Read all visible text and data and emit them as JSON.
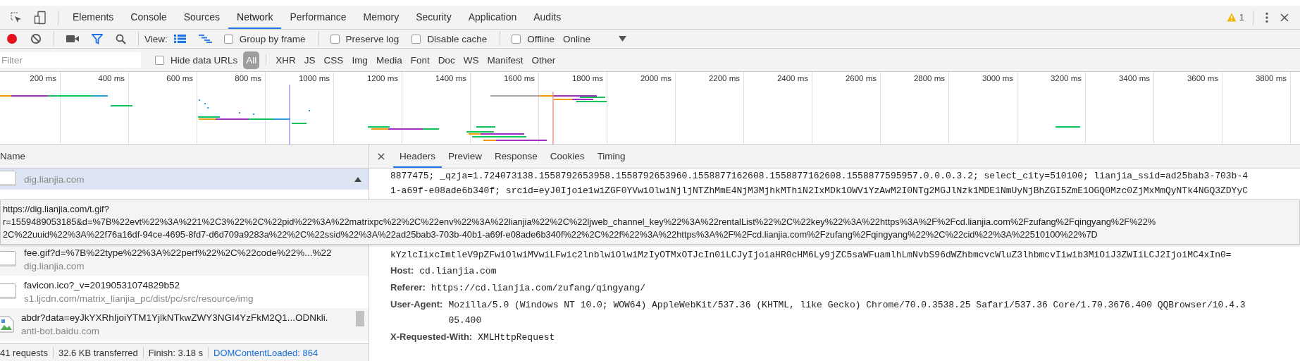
{
  "main_tabs": [
    {
      "label": "Elements",
      "selected": false
    },
    {
      "label": "Console",
      "selected": false
    },
    {
      "label": "Sources",
      "selected": false
    },
    {
      "label": "Network",
      "selected": true
    },
    {
      "label": "Performance",
      "selected": false
    },
    {
      "label": "Memory",
      "selected": false
    },
    {
      "label": "Security",
      "selected": false
    },
    {
      "label": "Application",
      "selected": false
    },
    {
      "label": "Audits",
      "selected": false
    }
  ],
  "issues": {
    "count": "1"
  },
  "toolbar": {
    "recording": true,
    "filter_active": true,
    "view_label": "View:",
    "view_modes": [
      {
        "kind": "list",
        "selected": true
      },
      {
        "kind": "waterfall",
        "selected": false
      }
    ],
    "group_by_frame": {
      "label": "Group by frame",
      "checked": false
    },
    "preserve_log": {
      "label": "Preserve log",
      "checked": false
    },
    "disable_cache": {
      "label": "Disable cache",
      "checked": false
    },
    "offline": {
      "label": "Offline",
      "checked": false
    },
    "throttling": "Online"
  },
  "filter": {
    "placeholder": "Filter",
    "hide_data_urls": {
      "label": "Hide data URLs",
      "checked": false
    },
    "types": [
      {
        "label": "All",
        "selected": true
      },
      {
        "label": "XHR",
        "selected": false
      },
      {
        "label": "JS",
        "selected": false
      },
      {
        "label": "CSS",
        "selected": false
      },
      {
        "label": "Img",
        "selected": false
      },
      {
        "label": "Media",
        "selected": false
      },
      {
        "label": "Font",
        "selected": false
      },
      {
        "label": "Doc",
        "selected": false
      },
      {
        "label": "WS",
        "selected": false
      },
      {
        "label": "Manifest",
        "selected": false
      },
      {
        "label": "Other",
        "selected": false
      }
    ]
  },
  "timeline": {
    "ticks": [
      "200 ms",
      "400 ms",
      "600 ms",
      "800 ms",
      "1000 ms",
      "1200 ms",
      "1400 ms",
      "1600 ms",
      "1800 ms",
      "2000 ms",
      "2200 ms",
      "2400 ms",
      "2600 ms",
      "2800 ms",
      "3000 ms",
      "3200 ms",
      "3400 ms",
      "3600 ms",
      "3800 ms"
    ]
  },
  "requests": {
    "header": "Name",
    "rows": [
      {
        "kind": "document",
        "domain": "dig.lianjia.com",
        "selected": true
      },
      {
        "kind": "document",
        "name": "fee.gif?d=%7B%22type%22%3A%22perf%22%2C%22code%22%...%22",
        "domain": "dig.lianjia.com",
        "selected": false
      },
      {
        "kind": "document",
        "name": "favicon.ico?_v=20190531074829b52",
        "domain": "s1.ljcdn.com/matrix_lianjia_pc/dist/pc/src/resource/img",
        "selected": false
      },
      {
        "kind": "image",
        "name": "abdr?data=eyJkYXRhIjoiYTM1YjlkNTkwZWY3NGI4YzFkM2Q1...ODNkli.",
        "domain": "anti-bot.baidu.com",
        "selected": false
      }
    ]
  },
  "tooltip": {
    "lines": [
      "https://dig.lianjia.com/t.gif?",
      "r=1559489053185&d=%7B%22evt%22%3A%221%2C3%22%2C%22pid%22%3A%22matrixpc%22%2C%22env%22%3A%22lianjia%22%2C%22ljweb_channel_key%22%3A%22rentalList%22%2C%22key%22%3A%22https%3A%2F%2Fcd.lianjia.com%2Fzufang%2Fqingyang%2F%22%",
      "2C%22uuid%22%3A%22f76a16df-94ce-4695-8fd7-d6d709a9283a%22%2C%22ssid%22%3A%22ad25bab3-703b-40b1-a69f-e08ade6b340f%22%2C%22f%22%3A%22https%3A%2F%2Fcd.lianjia.com%2Fzufang%2Fqingyang%22%2C%22cid%22%3A%22510100%22%7D"
    ]
  },
  "detail": {
    "tabs": [
      {
        "label": "Headers",
        "selected": true
      },
      {
        "label": "Preview",
        "selected": false
      },
      {
        "label": "Response",
        "selected": false
      },
      {
        "label": "Cookies",
        "selected": false
      },
      {
        "label": "Timing",
        "selected": false
      }
    ],
    "lines": [
      {
        "kind": "raw",
        "text": "8877475; _qzja=1.724073138.1558792653958.1558792653960.1558877162608.1558877162608.1558877595957.0.0.0.3.2; select_city=510100; lianjia_ssid=ad25bab3-703b-4"
      },
      {
        "kind": "raw",
        "text": "1-a69f-e08ade6b340f; srcid=eyJ0Ijoie1wiZGF0YVwiOlwiNjljNTZhMmE4NjM3MjhkMThiN2IxMDk1OWViYzAwM2I0NTg2MGJlNzk1MDE1NmUyNjBhZGI5ZmE1OGQ0Mzc0ZjMxMmQyNTk4NGQ3ZDYyC"
      },
      {
        "kind": "gap"
      },
      {
        "kind": "raw",
        "text": "kYzlcIixcImtleV9pZFwiOlwiMVwiLFwic2lnblwiOlwiMzIyOTMxOTJcIn0iLCJyIjoiaHR0cHM6Ly9jZC5saWFuamlhLmNvbS96dWZhbmcvcWluZ3lhbmcvIiwib3MiOiJ3ZWIiLCJ2IjoiMC4xIn0="
      },
      {
        "kind": "header",
        "name": "Host:",
        "value": "cd.lianjia.com"
      },
      {
        "kind": "header",
        "name": "Referer:",
        "value": "https://cd.lianjia.com/zufang/qingyang/"
      },
      {
        "kind": "header",
        "name": "User-Agent:",
        "value": "Mozilla/5.0 (Windows NT 10.0; WOW64) AppleWebKit/537.36 (KHTML, like Gecko) Chrome/70.0.3538.25 Safari/537.36 Core/1.70.3676.400 QQBrowser/10.4.3",
        "cont": "05.400"
      },
      {
        "kind": "header",
        "name": "X-Requested-With:",
        "value": "XMLHttpRequest"
      }
    ]
  },
  "status": [
    {
      "kind": "plain",
      "text": "41 requests"
    },
    {
      "kind": "plain",
      "text": "32.6 KB transferred"
    },
    {
      "kind": "plain",
      "text": "Finish: 3.18 s"
    },
    {
      "kind": "link",
      "text": "DOMContentLoaded: 864"
    }
  ]
}
